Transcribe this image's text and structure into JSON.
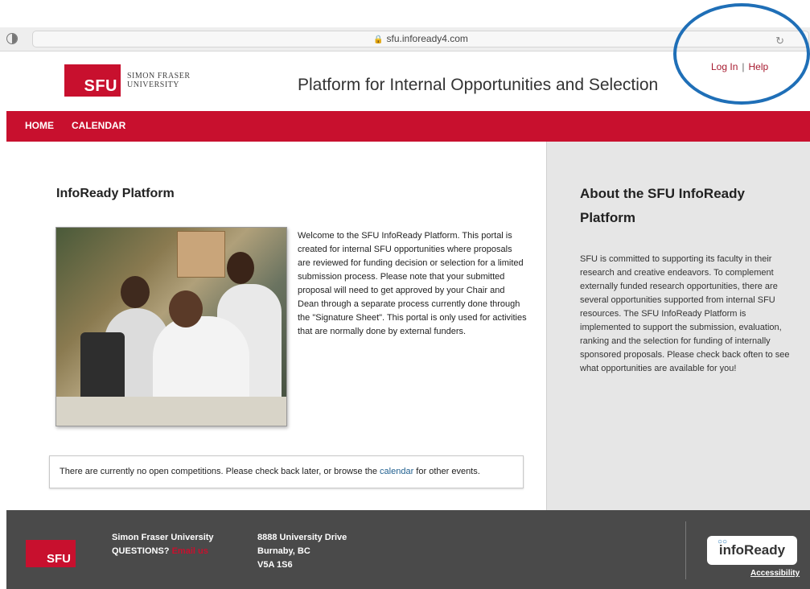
{
  "browser": {
    "url": "sfu.infoready4.com"
  },
  "header": {
    "logo_box": "SFU",
    "logo_line1": "SIMON FRASER",
    "logo_line2": "UNIVERSITY",
    "site_title": "Platform for Internal Opportunities and Selection",
    "login": "Log In",
    "separator": "|",
    "help": "Help"
  },
  "nav": {
    "home": "HOME",
    "calendar": "CALENDAR"
  },
  "main": {
    "title": "InfoReady Platform",
    "intro": "Welcome to the SFU InfoReady Platform. This portal is created for internal SFU opportunities where proposals are reviewed for funding decision or selection for a limited submission process. Please note that your submitted proposal will need to get approved by your Chair and Dean through a separate process currently done through the \"Signature Sheet\". This portal is only used for activities that are normally done by external funders.",
    "notice_before": "There are currently no open competitions. Please check back later, or browse the ",
    "notice_link": "calendar",
    "notice_after": " for other events."
  },
  "sidebar": {
    "title": "About the SFU InfoReady Platform",
    "body": "SFU is committed to supporting its faculty in their research and creative endeavors. To complement externally funded research opportunities, there are several opportunities supported from internal SFU resources. The SFU InfoReady Platform is implemented to support the submission, evaluation, ranking and the selection for funding of internally sponsored proposals. Please check back often to see what opportunities are available for you!"
  },
  "footer": {
    "logo": "SFU",
    "org": "Simon Fraser University",
    "questions": "QUESTIONS?",
    "email": "Email us",
    "address1": "8888 University Drive",
    "address2": "Burnaby, BC",
    "address3": "V5A 1S6",
    "infoready": "infoReady",
    "accessibility": "Accessibility"
  },
  "colors": {
    "brand_red": "#c8102e",
    "annotation_circle": "#1f6fb7"
  }
}
